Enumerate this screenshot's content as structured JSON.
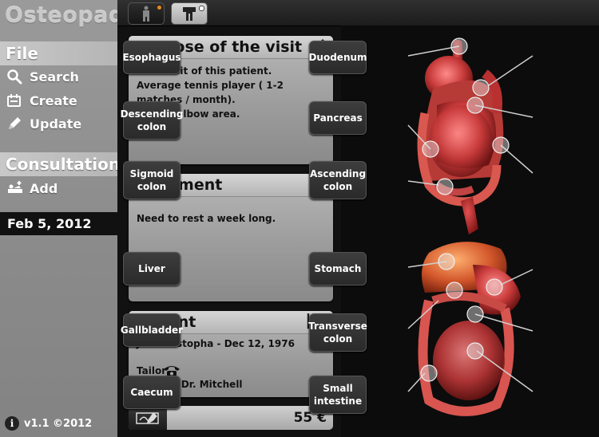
{
  "app": {
    "title": "Osteopad",
    "version": "v1.1 ©2012"
  },
  "sidebar": {
    "file_section": "File",
    "file_items": [
      {
        "label": "Search",
        "icon": "search-icon"
      },
      {
        "label": "Create",
        "icon": "create-icon"
      },
      {
        "label": "Update",
        "icon": "pencil-icon"
      }
    ],
    "consult_section": "Consultations",
    "consult_items": [
      {
        "label": "Add",
        "icon": "add-consultation-icon"
      }
    ],
    "selected_date": "Feb 5, 2012"
  },
  "topbar": {
    "tabs": [
      {
        "icon": "body-figure-icon",
        "badge_color": "#e8891a"
      },
      {
        "icon": "torso-icon",
        "badge_color": "#ffffff"
      }
    ]
  },
  "purpose": {
    "title": "Purpose of the visit",
    "lines": [
      "First visit of this patient.",
      "Average tennis player ( 1-2 matches / month).",
      "Pain in elbow area."
    ]
  },
  "treatment": {
    "title": "Treatment",
    "lines": [
      "Need to rest a week long."
    ]
  },
  "patient": {
    "title": "Patient",
    "name_line": "John Mistopha - Dec 12, 1976",
    "occupation": "Tailor",
    "referral": "Sent by Dr. Mitchell"
  },
  "fee": {
    "amount": "55 €"
  },
  "anatomy": {
    "upper_labels": [
      "Esophagus",
      "Duodenum",
      "Descending colon",
      "Pancreas",
      "Sigmoid colon",
      "Ascending colon"
    ],
    "lower_labels": [
      "Liver",
      "Stomach",
      "Gallbladder",
      "Transverse colon",
      "Caecum",
      "Small intestine"
    ]
  },
  "colors": {
    "accent_badge": "#e8891a",
    "organ_red": "#c83a3a"
  }
}
